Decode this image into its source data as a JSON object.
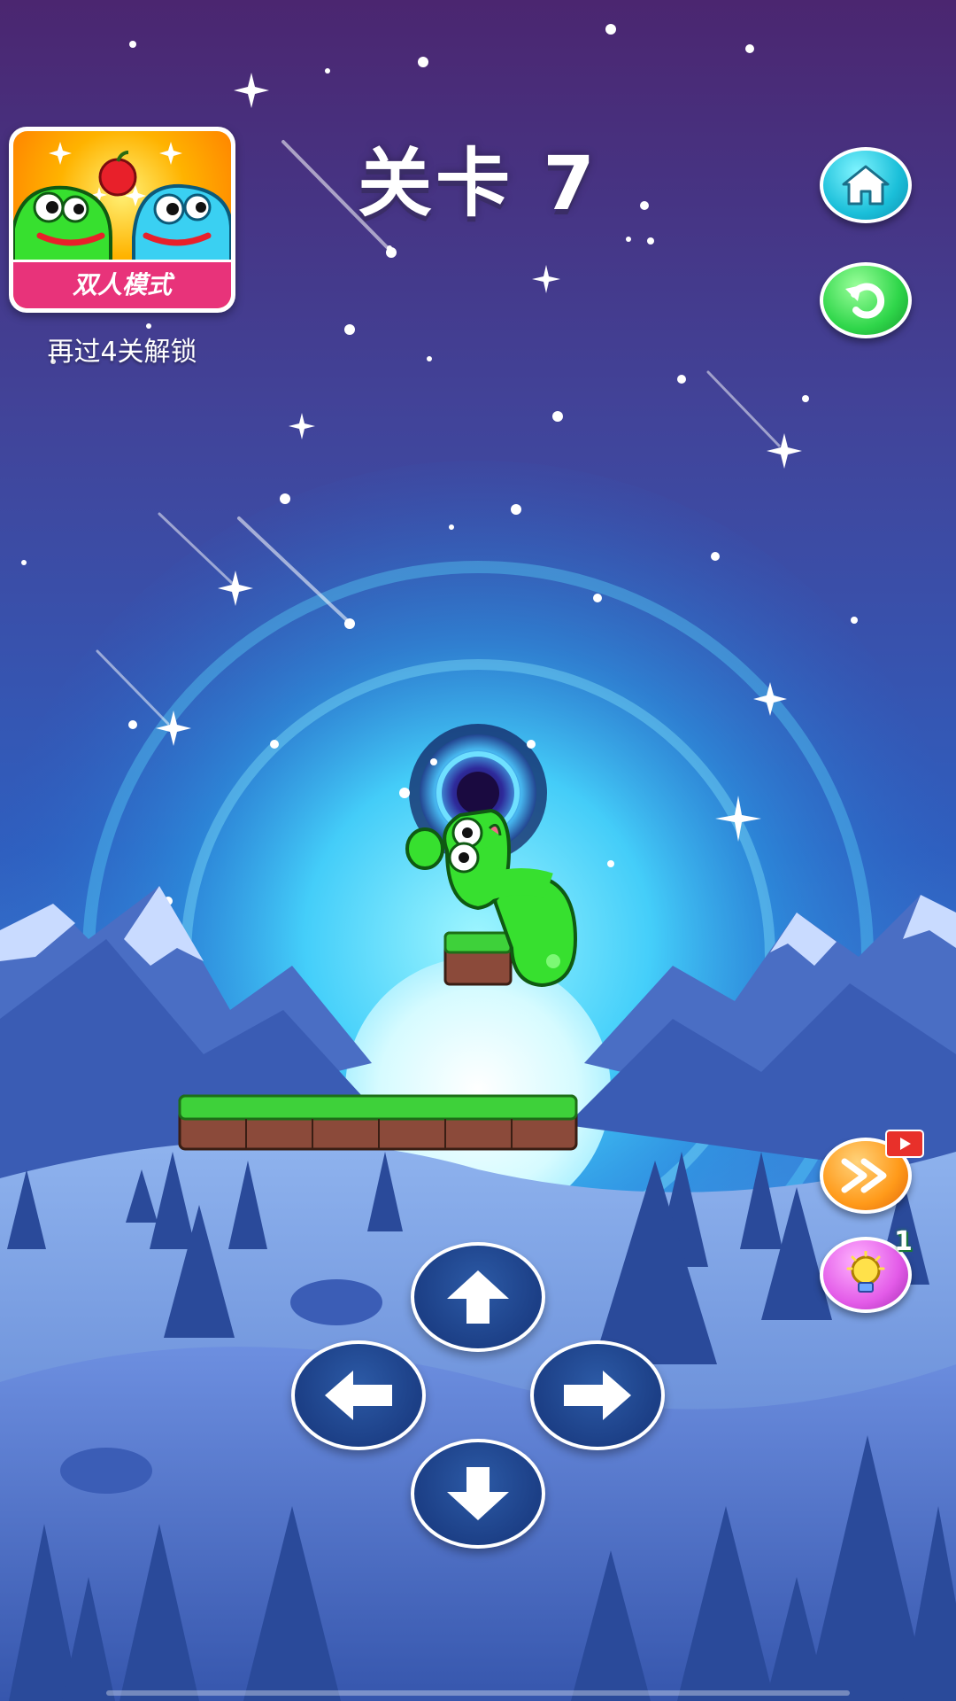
{
  "header": {
    "level_title": "关卡 7"
  },
  "two_player_mode": {
    "label": "双人模式",
    "unlock_hint": "再过4关解锁"
  },
  "side_buttons": {
    "home": "home-icon",
    "restart": "restart-icon",
    "skip": "fast-forward-icon",
    "hint": "lightbulb-icon",
    "hint_count": "1"
  },
  "controls": {
    "up": "arrow-up-icon",
    "left": "arrow-left-icon",
    "right": "arrow-right-icon",
    "down": "arrow-down-icon"
  },
  "colors": {
    "sky_top": "#4a2a7a",
    "sky_mid": "#3a62c9",
    "glow": "#4fe3ff",
    "grass": "#3ed13a",
    "dirt": "#8b4a3a",
    "worm": "#37e02f"
  }
}
